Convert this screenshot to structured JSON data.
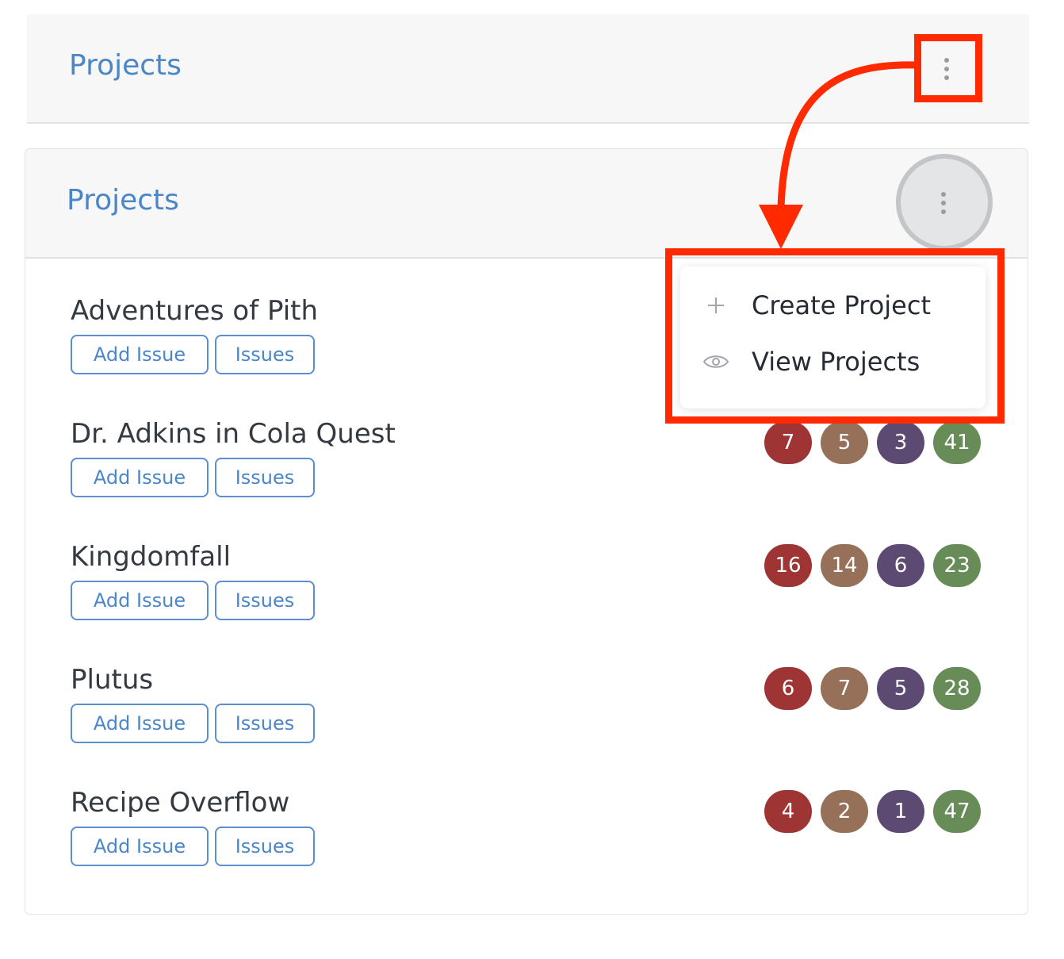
{
  "top_panel": {
    "title": "Projects"
  },
  "card": {
    "title": "Projects"
  },
  "dropdown": {
    "items": [
      {
        "label": "Create Project",
        "icon": "plus-icon"
      },
      {
        "label": "View Projects",
        "icon": "eye-icon"
      }
    ]
  },
  "projects": [
    {
      "name": "Adventures of Pith",
      "add_issue": "Add Issue",
      "issues": "Issues",
      "counts": []
    },
    {
      "name": "Dr. Adkins in Cola Quest",
      "add_issue": "Add Issue",
      "issues": "Issues",
      "counts": [
        "7",
        "5",
        "3",
        "41"
      ]
    },
    {
      "name": "Kingdomfall",
      "add_issue": "Add Issue",
      "issues": "Issues",
      "counts": [
        "16",
        "14",
        "6",
        "23"
      ]
    },
    {
      "name": "Plutus",
      "add_issue": "Add Issue",
      "issues": "Issues",
      "counts": [
        "6",
        "7",
        "5",
        "28"
      ]
    },
    {
      "name": "Recipe Overflow",
      "add_issue": "Add Issue",
      "issues": "Issues",
      "counts": [
        "4",
        "2",
        "1",
        "47"
      ]
    }
  ],
  "colors": {
    "accent": "#4a86c8",
    "badge_colors": [
      "#9e3434",
      "#97705a",
      "#5c4a72",
      "#678c57"
    ],
    "highlight": "#ff2a00"
  }
}
